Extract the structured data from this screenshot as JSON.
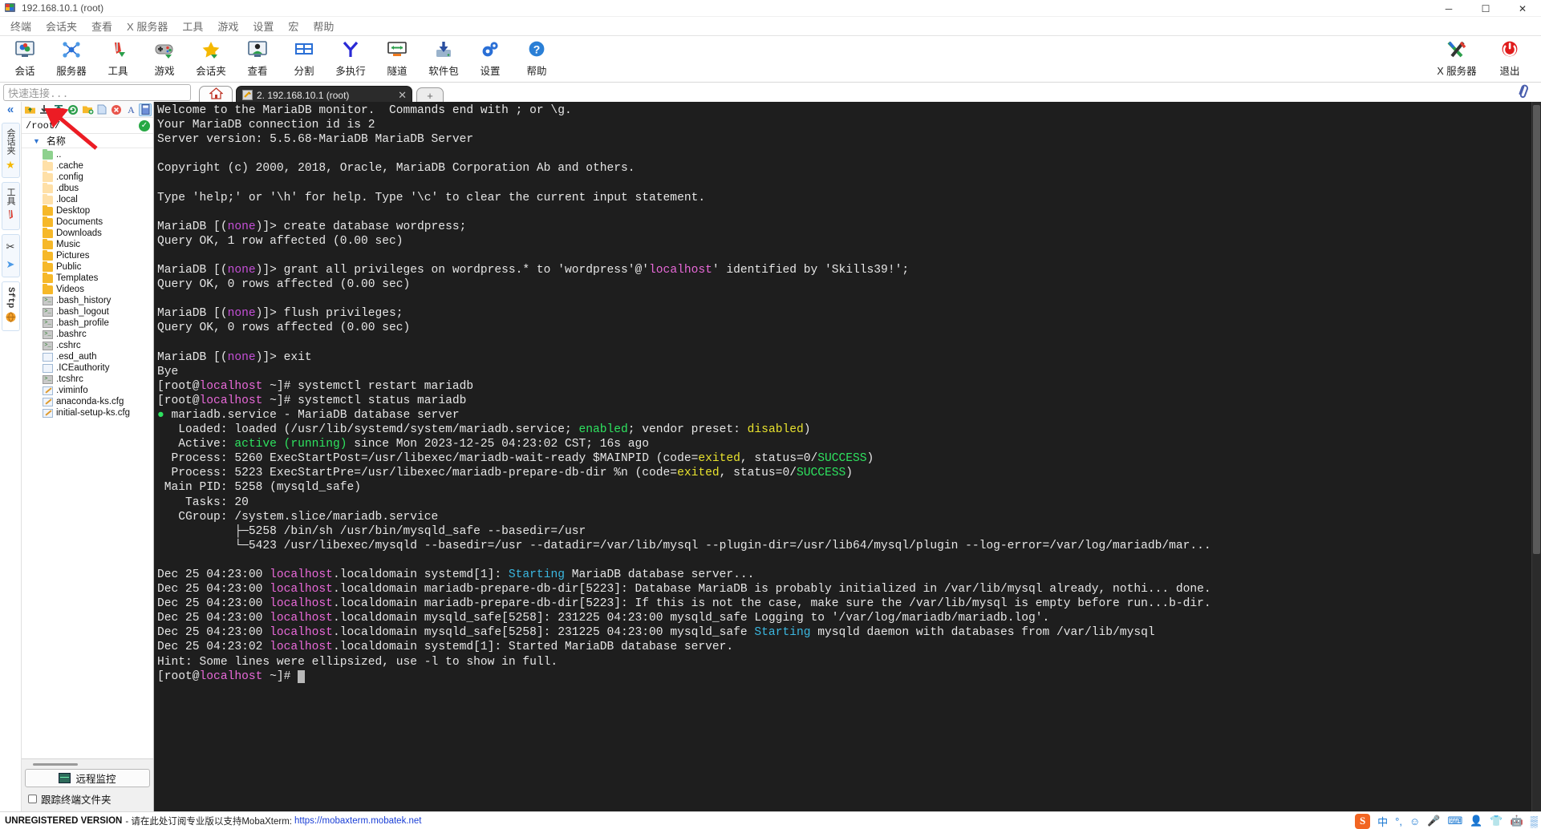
{
  "window": {
    "title": "192.168.10.1 (root)",
    "minimize": "─",
    "maximize": "☐",
    "close": "✕"
  },
  "menubar": {
    "items": [
      {
        "label": "终端",
        "name": "menu-terminal"
      },
      {
        "label": "会话夹",
        "name": "menu-sessions"
      },
      {
        "label": "查看",
        "name": "menu-view"
      },
      {
        "label": "X 服务器",
        "name": "menu-xserver"
      },
      {
        "label": "工具",
        "name": "menu-tools"
      },
      {
        "label": "游戏",
        "name": "menu-games"
      },
      {
        "label": "设置",
        "name": "menu-settings"
      },
      {
        "label": "宏",
        "name": "menu-macros"
      },
      {
        "label": "帮助",
        "name": "menu-help"
      }
    ]
  },
  "toolbar": {
    "items": [
      {
        "label": "会话",
        "name": "toolbar-session",
        "icon": "monitor-icon"
      },
      {
        "label": "服务器",
        "name": "toolbar-servers",
        "icon": "network-icon"
      },
      {
        "label": "工具",
        "name": "toolbar-tools",
        "icon": "knife-icon"
      },
      {
        "label": "游戏",
        "name": "toolbar-games",
        "icon": "gamepad-icon"
      },
      {
        "label": "会话夹",
        "name": "toolbar-sessions-folder",
        "icon": "star-icon"
      },
      {
        "label": "查看",
        "name": "toolbar-view",
        "icon": "user-monitor-icon"
      },
      {
        "label": "分割",
        "name": "toolbar-split",
        "icon": "split-icon"
      },
      {
        "label": "多执行",
        "name": "toolbar-multiexec",
        "icon": "fork-icon"
      },
      {
        "label": "隧道",
        "name": "toolbar-tunneling",
        "icon": "tunnel-icon"
      },
      {
        "label": "软件包",
        "name": "toolbar-packages",
        "icon": "download-icon"
      },
      {
        "label": "设置",
        "name": "toolbar-settings",
        "icon": "gear-icon"
      },
      {
        "label": "帮助",
        "name": "toolbar-help",
        "icon": "question-icon"
      }
    ],
    "right_items": [
      {
        "label": "X 服务器",
        "name": "toolbar-xserver",
        "icon": "x-logo-icon"
      },
      {
        "label": "退出",
        "name": "toolbar-exit",
        "icon": "power-icon"
      }
    ]
  },
  "quickbar": {
    "placeholder": "快速连接...",
    "home_tab": "home-icon",
    "tab_label": "2. 192.168.10.1 (root)",
    "tab_close": "✕",
    "new_tab": "+",
    "clip": "paperclip-icon"
  },
  "rail": {
    "collapse": "«",
    "groups": [
      {
        "name": "rail-sessions",
        "text": "会话夹",
        "icon": "star-icon",
        "glyph": "★"
      },
      {
        "name": "rail-tools",
        "text": "工具",
        "icon": "knife-icon",
        "glyph": "🔪"
      },
      {
        "name": "rail-macros",
        "text": "",
        "icon": "scissors-icon",
        "glyph": "✂"
      },
      {
        "name": "rail-sftp",
        "text": "Sftp",
        "icon": "globe-icon",
        "glyph": "🌐"
      }
    ]
  },
  "sftp": {
    "buttons": [
      {
        "name": "parent-dir-button",
        "glyph": "↑",
        "selected": false
      },
      {
        "name": "download-button",
        "glyph": "↓",
        "selected": false
      },
      {
        "name": "upload-button",
        "glyph": "⇧",
        "selected": false
      },
      {
        "name": "refresh-button",
        "glyph": "↻",
        "selected": false
      },
      {
        "name": "new-folder-button",
        "glyph": "📁",
        "selected": false
      },
      {
        "name": "new-file-button",
        "glyph": "🗋",
        "selected": false
      },
      {
        "name": "delete-button",
        "glyph": "✖",
        "selected": false
      },
      {
        "name": "text-mode-button",
        "glyph": "A",
        "selected": false
      },
      {
        "name": "view-mode-button",
        "glyph": "▒",
        "selected": true
      }
    ],
    "path": "/root/",
    "path_ok": "✓",
    "column_header": "名称",
    "files": [
      {
        "name": "..",
        "type": "parent"
      },
      {
        "name": ".cache",
        "type": "folder-dim"
      },
      {
        "name": ".config",
        "type": "folder-dim"
      },
      {
        "name": ".dbus",
        "type": "folder-dim"
      },
      {
        "name": ".local",
        "type": "folder-dim"
      },
      {
        "name": "Desktop",
        "type": "folder"
      },
      {
        "name": "Documents",
        "type": "folder"
      },
      {
        "name": "Downloads",
        "type": "folder"
      },
      {
        "name": "Music",
        "type": "folder"
      },
      {
        "name": "Pictures",
        "type": "folder"
      },
      {
        "name": "Public",
        "type": "folder"
      },
      {
        "name": "Templates",
        "type": "folder"
      },
      {
        "name": "Videos",
        "type": "folder"
      },
      {
        "name": ".bash_history",
        "type": "shell"
      },
      {
        "name": ".bash_logout",
        "type": "shell"
      },
      {
        "name": ".bash_profile",
        "type": "shell"
      },
      {
        "name": ".bashrc",
        "type": "shell"
      },
      {
        "name": ".cshrc",
        "type": "shell"
      },
      {
        "name": ".esd_auth",
        "type": "doc"
      },
      {
        "name": ".ICEauthority",
        "type": "doc"
      },
      {
        "name": ".tcshrc",
        "type": "shell"
      },
      {
        "name": ".viminfo",
        "type": "cfg"
      },
      {
        "name": "anaconda-ks.cfg",
        "type": "cfg"
      },
      {
        "name": "initial-setup-ks.cfg",
        "type": "cfg"
      }
    ],
    "monitor_button": "远程监控",
    "follow_terminal": "跟踪终端文件夹"
  },
  "terminal": {
    "lines": [
      [
        {
          "t": "Welcome to the MariaDB monitor.  Commands end with ; or \\g.",
          "c": "c-wht"
        }
      ],
      [
        {
          "t": "Your MariaDB connection id is 2",
          "c": "c-wht"
        }
      ],
      [
        {
          "t": "Server version: 5.5.68-MariaDB MariaDB Server",
          "c": "c-wht"
        }
      ],
      [],
      [
        {
          "t": "Copyright (c) 2000, 2018, Oracle, MariaDB Corporation Ab and others.",
          "c": "c-wht"
        }
      ],
      [],
      [
        {
          "t": "Type 'help;' or '\\h' for help. Type '\\c' to clear the current input statement.",
          "c": "c-wht"
        }
      ],
      [],
      [
        {
          "t": "MariaDB [(",
          "c": "c-wht"
        },
        {
          "t": "none",
          "c": "c-pur"
        },
        {
          "t": ")]> create database wordpress;",
          "c": "c-wht"
        }
      ],
      [
        {
          "t": "Query OK, 1 row affected (0.00 sec)",
          "c": "c-wht"
        }
      ],
      [],
      [
        {
          "t": "MariaDB [(",
          "c": "c-wht"
        },
        {
          "t": "none",
          "c": "c-pur"
        },
        {
          "t": ")]> grant all privileges on wordpress.* to 'wordpress'@'",
          "c": "c-wht"
        },
        {
          "t": "localhost",
          "c": "c-mag"
        },
        {
          "t": "' identified by 'Skills39!';",
          "c": "c-wht"
        }
      ],
      [
        {
          "t": "Query OK, 0 rows affected (0.00 sec)",
          "c": "c-wht"
        }
      ],
      [],
      [
        {
          "t": "MariaDB [(",
          "c": "c-wht"
        },
        {
          "t": "none",
          "c": "c-pur"
        },
        {
          "t": ")]> flush privileges;",
          "c": "c-wht"
        }
      ],
      [
        {
          "t": "Query OK, 0 rows affected (0.00 sec)",
          "c": "c-wht"
        }
      ],
      [],
      [
        {
          "t": "MariaDB [(",
          "c": "c-wht"
        },
        {
          "t": "none",
          "c": "c-pur"
        },
        {
          "t": ")]> exit",
          "c": "c-wht"
        }
      ],
      [
        {
          "t": "Bye",
          "c": "c-wht"
        }
      ],
      [
        {
          "t": "[root@",
          "c": "c-wht"
        },
        {
          "t": "localhost",
          "c": "c-mag"
        },
        {
          "t": " ~]# systemctl restart mariadb",
          "c": "c-wht"
        }
      ],
      [
        {
          "t": "[root@",
          "c": "c-wht"
        },
        {
          "t": "localhost",
          "c": "c-mag"
        },
        {
          "t": " ~]# systemctl status mariadb",
          "c": "c-wht"
        }
      ],
      [
        {
          "t": "●",
          "c": "dot-grn"
        },
        {
          "t": " mariadb.service - MariaDB database server",
          "c": "c-wht"
        }
      ],
      [
        {
          "t": "   Loaded: loaded (/usr/lib/systemd/system/mariadb.service; ",
          "c": "c-wht"
        },
        {
          "t": "enabled",
          "c": "c-grn"
        },
        {
          "t": "; vendor preset: ",
          "c": "c-wht"
        },
        {
          "t": "disabled",
          "c": "c-ylw"
        },
        {
          "t": ")",
          "c": "c-wht"
        }
      ],
      [
        {
          "t": "   Active: ",
          "c": "c-wht"
        },
        {
          "t": "active (running)",
          "c": "c-grn"
        },
        {
          "t": " since Mon 2023-12-25 04:23:02 CST; 16s ago",
          "c": "c-wht"
        }
      ],
      [
        {
          "t": "  Process: 5260 ExecStartPost=/usr/libexec/mariadb-wait-ready $MAINPID (code=",
          "c": "c-wht"
        },
        {
          "t": "exited",
          "c": "c-ylw"
        },
        {
          "t": ", status=0/",
          "c": "c-wht"
        },
        {
          "t": "SUCCESS",
          "c": "c-grn"
        },
        {
          "t": ")",
          "c": "c-wht"
        }
      ],
      [
        {
          "t": "  Process: 5223 ExecStartPre=/usr/libexec/mariadb-prepare-db-dir %n (code=",
          "c": "c-wht"
        },
        {
          "t": "exited",
          "c": "c-ylw"
        },
        {
          "t": ", status=0/",
          "c": "c-wht"
        },
        {
          "t": "SUCCESS",
          "c": "c-grn"
        },
        {
          "t": ")",
          "c": "c-wht"
        }
      ],
      [
        {
          "t": " Main PID: 5258 (mysqld_safe)",
          "c": "c-wht"
        }
      ],
      [
        {
          "t": "    Tasks: 20",
          "c": "c-wht"
        }
      ],
      [
        {
          "t": "   CGroup: /system.slice/mariadb.service",
          "c": "c-wht"
        }
      ],
      [
        {
          "t": "           ├─5258 /bin/sh /usr/bin/mysqld_safe --basedir=/usr",
          "c": "c-wht"
        }
      ],
      [
        {
          "t": "           └─5423 /usr/libexec/mysqld --basedir=/usr --datadir=/var/lib/mysql --plugin-dir=/usr/lib64/mysql/plugin --log-error=/var/log/mariadb/mar...",
          "c": "c-wht"
        }
      ],
      [],
      [
        {
          "t": "Dec 25 04:23:00 ",
          "c": "c-wht"
        },
        {
          "t": "localhost",
          "c": "c-mag"
        },
        {
          "t": ".localdomain systemd[1]: ",
          "c": "c-wht"
        },
        {
          "t": "Starting",
          "c": "c-cyn"
        },
        {
          "t": " MariaDB database server...",
          "c": "c-wht"
        }
      ],
      [
        {
          "t": "Dec 25 04:23:00 ",
          "c": "c-wht"
        },
        {
          "t": "localhost",
          "c": "c-mag"
        },
        {
          "t": ".localdomain mariadb-prepare-db-dir[5223]: Database MariaDB is probably initialized in /var/lib/mysql already, nothi... done.",
          "c": "c-wht"
        }
      ],
      [
        {
          "t": "Dec 25 04:23:00 ",
          "c": "c-wht"
        },
        {
          "t": "localhost",
          "c": "c-mag"
        },
        {
          "t": ".localdomain mariadb-prepare-db-dir[5223]: If this is not the case, make sure the /var/lib/mysql is empty before run...b-dir.",
          "c": "c-wht"
        }
      ],
      [
        {
          "t": "Dec 25 04:23:00 ",
          "c": "c-wht"
        },
        {
          "t": "localhost",
          "c": "c-mag"
        },
        {
          "t": ".localdomain mysqld_safe[5258]: 231225 04:23:00 mysqld_safe Logging to '/var/log/mariadb/mariadb.log'.",
          "c": "c-wht"
        }
      ],
      [
        {
          "t": "Dec 25 04:23:00 ",
          "c": "c-wht"
        },
        {
          "t": "localhost",
          "c": "c-mag"
        },
        {
          "t": ".localdomain mysqld_safe[5258]: 231225 04:23:00 mysqld_safe ",
          "c": "c-wht"
        },
        {
          "t": "Starting",
          "c": "c-cyn"
        },
        {
          "t": " mysqld daemon with databases from /var/lib/mysql",
          "c": "c-wht"
        }
      ],
      [
        {
          "t": "Dec 25 04:23:02 ",
          "c": "c-wht"
        },
        {
          "t": "localhost",
          "c": "c-mag"
        },
        {
          "t": ".localdomain systemd[1]: Started MariaDB database server.",
          "c": "c-wht"
        }
      ],
      [
        {
          "t": "Hint: Some lines were ellipsized, use -l to show in full.",
          "c": "c-wht"
        }
      ],
      [
        {
          "t": "[root@",
          "c": "c-wht"
        },
        {
          "t": "localhost",
          "c": "c-mag"
        },
        {
          "t": " ~]# ",
          "c": "c-wht"
        },
        {
          "t": " ",
          "c": "cursor"
        }
      ]
    ]
  },
  "statusbar": {
    "unregistered": "UNREGISTERED VERSION",
    "message": "- 请在此处订阅专业版以支持MobaXterm:",
    "link": "https://mobaxterm.mobatek.net",
    "tray": [
      {
        "name": "sogou-ime-icon",
        "glyph": "S"
      },
      {
        "name": "ime-chinese-icon",
        "glyph": "中"
      },
      {
        "name": "ime-punctuation-icon",
        "glyph": "°,"
      },
      {
        "name": "ime-emoji-icon",
        "glyph": "☺"
      },
      {
        "name": "ime-voice-icon",
        "glyph": "🎤"
      },
      {
        "name": "ime-keyboard-icon",
        "glyph": "⌨"
      },
      {
        "name": "ime-account-icon",
        "glyph": "👤"
      },
      {
        "name": "ime-skin-icon",
        "glyph": "👕"
      },
      {
        "name": "ime-robot-icon",
        "glyph": "🤖"
      },
      {
        "name": "ime-apps-icon",
        "glyph": "▒"
      }
    ]
  }
}
